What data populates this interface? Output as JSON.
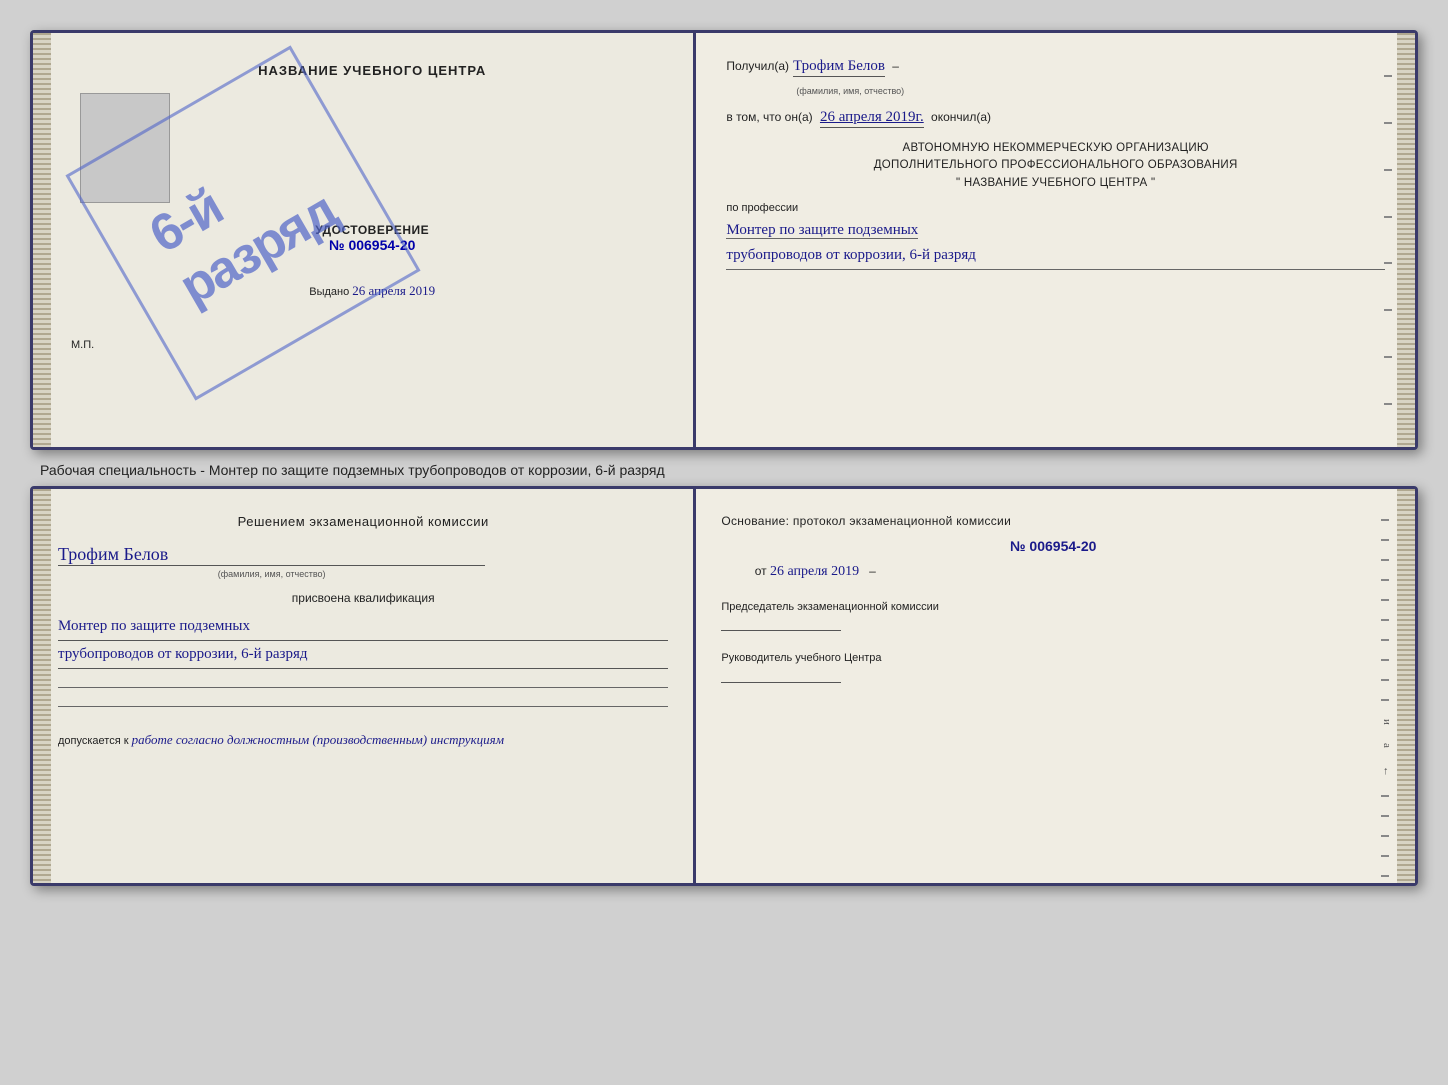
{
  "page": {
    "background_color": "#d0d0d0"
  },
  "cert_book": {
    "left": {
      "title": "НАЗВАНИЕ УЧЕБНОГО ЦЕНТРА",
      "udost_title": "УДОСТОВЕРЕНИЕ",
      "udost_num": "№ 006954-20",
      "vydano_label": "Выдано",
      "vydano_date": "26 апреля 2019",
      "mp": "М.П."
    },
    "stamp": {
      "text": "6-й разряд"
    },
    "right": {
      "poluchil_label": "Получил(а)",
      "poluchil_name": "Трофим Белов",
      "poluchil_subtitle": "(фамилия, имя, отчество)",
      "dash": "–",
      "vtom_label": "в том, что он(а)",
      "vtom_date": "26 апреля 2019г.",
      "okonchil": "окончил(а)",
      "org_line1": "АВТОНОМНУЮ НЕКОММЕРЧЕСКУЮ ОРГАНИЗАЦИЮ",
      "org_line2": "ДОПОЛНИТЕЛЬНОГО ПРОФЕССИОНАЛЬНОГО ОБРАЗОВАНИЯ",
      "org_quotes1": "\"",
      "org_name": "НАЗВАНИЕ УЧЕБНОГО ЦЕНТРА",
      "org_quotes2": "\"",
      "po_professii": "по профессии",
      "profession_line1": "Монтер по защите подземных",
      "profession_line2": "трубопроводов от коррозии, 6-й разряд"
    }
  },
  "middle_text": "Рабочая специальность - Монтер по защите подземных трубопроводов от коррозии, 6-й разряд",
  "bottom_book": {
    "left": {
      "section_title": "Решением экзаменационной комиссии",
      "name": "Трофим Белов",
      "name_subtitle": "(фамилия, имя, отчество)",
      "prisvoena": "присвоена квалификация",
      "qualification_line1": "Монтер по защите подземных",
      "qualification_line2": "трубопроводов от коррозии, 6-й разряд",
      "dopuskaetsya_label": "допускается к",
      "dopuskaetsya_value": "работе согласно должностным (производственным) инструкциям"
    },
    "right": {
      "osnovanie_label": "Основание: протокол экзаменационной комиссии",
      "num": "№  006954-20",
      "ot_label": "от",
      "ot_date": "26 апреля 2019",
      "chairman_title": "Председатель экзаменационной комиссии",
      "rukovoditel_title": "Руководитель учебного Центра"
    }
  }
}
